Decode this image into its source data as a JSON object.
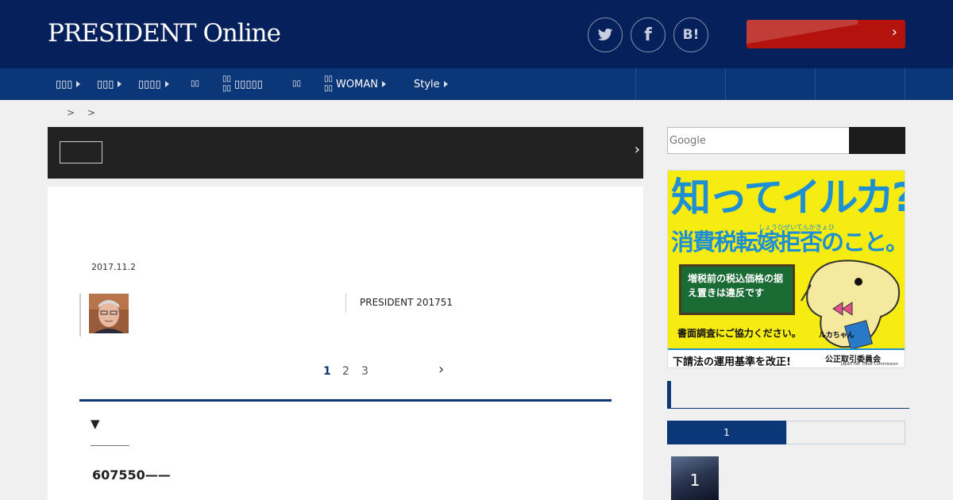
{
  "header": {
    "logo": "PRESIDENT Online",
    "social": [
      {
        "name": "twitter",
        "glyph": "🐦",
        "icon": "twitter-icon"
      },
      {
        "name": "facebook",
        "glyph": "f",
        "icon": "facebook-icon"
      },
      {
        "name": "hatena",
        "glyph": "B!",
        "icon": "hatena-bookmark-icon"
      }
    ],
    "cta_arrow": "›",
    "colors": {
      "header_bg": "#05205b",
      "nav_bg": "#0b3677",
      "cta_bg": "#b4120c"
    }
  },
  "nav": {
    "items": [
      {
        "label": "▯▯▯"
      },
      {
        "label": "▯▯▯"
      },
      {
        "label": "▯▯▯▯"
      },
      {
        "label": "▯▯"
      },
      {
        "top": "▯▯",
        "bottom": "▯▯",
        "label": "▯▯▯▯▯"
      },
      {
        "label": "▯▯"
      },
      {
        "top": "▯▯",
        "bottom": "▯▯",
        "label": "WOMAN"
      },
      {
        "label": "Style"
      }
    ]
  },
  "breadcrumb": {
    "separators": ">>"
  },
  "banner": {
    "arrow": "›"
  },
  "article": {
    "date": "2017.11.2",
    "source": "PRESIDENT 201751",
    "pages": [
      "1",
      "2",
      "3"
    ],
    "current_page": "1",
    "next_arrow": "›",
    "toc_marker": "▼",
    "heading": "607550——"
  },
  "sidebar": {
    "search_placeholder": "Google",
    "ad": {
      "title": "知ってイルカ?",
      "ruby": "しょうひぜいてんかきょひ",
      "subtitle": "消費税転嫁拒否のこと。",
      "board": "増税前の税込価格の据え置きは違反です",
      "footnote": "書面調査にご協力ください。",
      "mascot_name": "ルカちゃん",
      "foot": "下請法の運用基準を改正!",
      "agency": "公正取引委員会",
      "agency_en": "Japan Fair Trade Commission"
    },
    "ranking_tab": "1",
    "ranking_number": "1"
  }
}
